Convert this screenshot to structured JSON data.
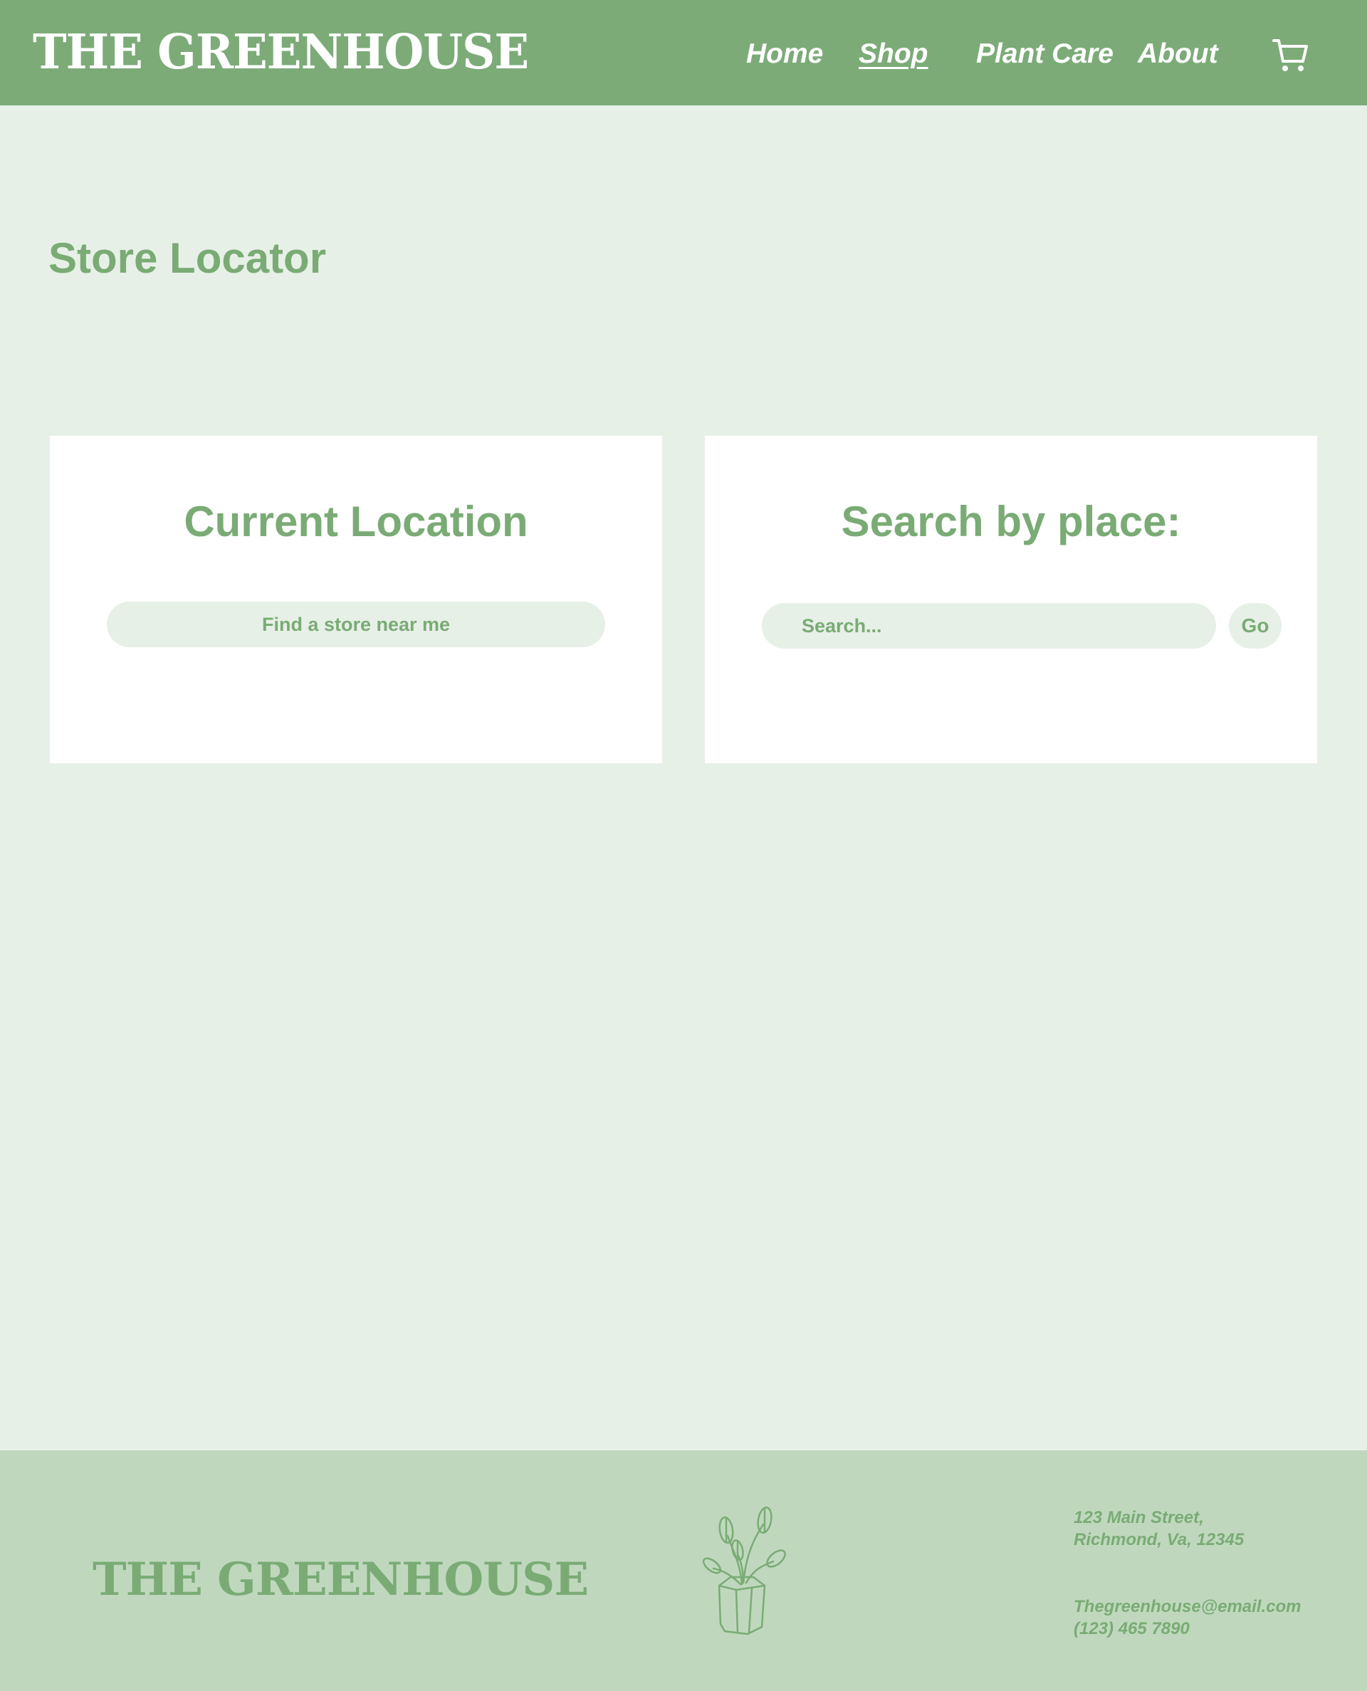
{
  "header": {
    "logo": "THE GREENHOUSE",
    "nav": [
      {
        "label": "Home",
        "active": false
      },
      {
        "label": "Shop",
        "active": true
      },
      {
        "label": "Plant Care",
        "active": false
      },
      {
        "label": "About",
        "active": false
      }
    ],
    "cart_icon": "shopping-cart-icon"
  },
  "main": {
    "title": "Store Locator",
    "current_location": {
      "title": "Current Location",
      "button_label": "Find a store near me"
    },
    "search_by_place": {
      "title": "Search by place:",
      "search_placeholder": "Search...",
      "search_value": "",
      "go_label": "Go"
    }
  },
  "footer": {
    "logo": "THE GREENHOUSE",
    "plant_icon": "potted-plant-icon",
    "address_line1": "123 Main Street,",
    "address_line2": "Richmond, Va, 12345",
    "email": "Thegreenhouse@email.com",
    "phone": "(123) 465 7890"
  },
  "colors": {
    "header_bg": "#7cab78",
    "page_bg": "#e7f0e7",
    "accent": "#7aab75",
    "footer_bg": "#bfd8bd",
    "card_bg": "#ffffff"
  }
}
